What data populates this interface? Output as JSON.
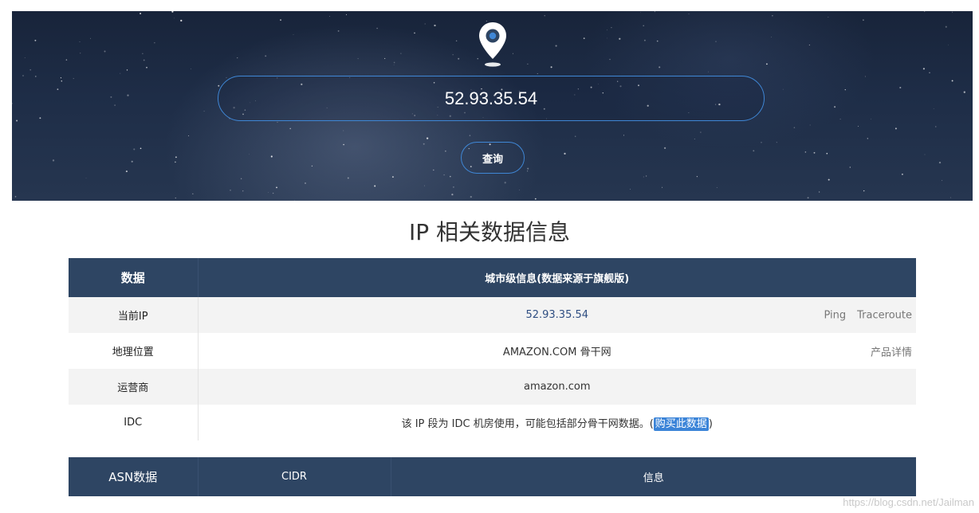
{
  "hero": {
    "ip_value": "52.93.35.54",
    "query_label": "查询",
    "pin_icon": "location-pin-icon"
  },
  "section_title": "IP 相关数据信息",
  "info_table": {
    "header": {
      "col1": "数据",
      "col2": "城市级信息(数据来源于旗舰版)"
    },
    "rows": [
      {
        "label": "当前IP",
        "value": "52.93.35.54",
        "actions": [
          "Ping",
          "Traceroute"
        ]
      },
      {
        "label": "地理位置",
        "value": "AMAZON.COM 骨干网",
        "actions": [
          "产品详情"
        ]
      },
      {
        "label": "运营商",
        "value": "amazon.com"
      },
      {
        "label": "IDC",
        "value_prefix": "该 IP 段为 IDC 机房使用，可能包括部分骨干网数据。(",
        "link": "购买此数据",
        "value_suffix": ")"
      }
    ]
  },
  "asn_table": {
    "header": {
      "col1": "ASN数据",
      "col2": "CIDR",
      "col3": "信息"
    }
  },
  "watermark": "https://blog.csdn.net/Jailman",
  "colors": {
    "accent_blue": "#3f87d6",
    "header_bg": "#2e4563",
    "ip_text": "#2f4e82"
  }
}
